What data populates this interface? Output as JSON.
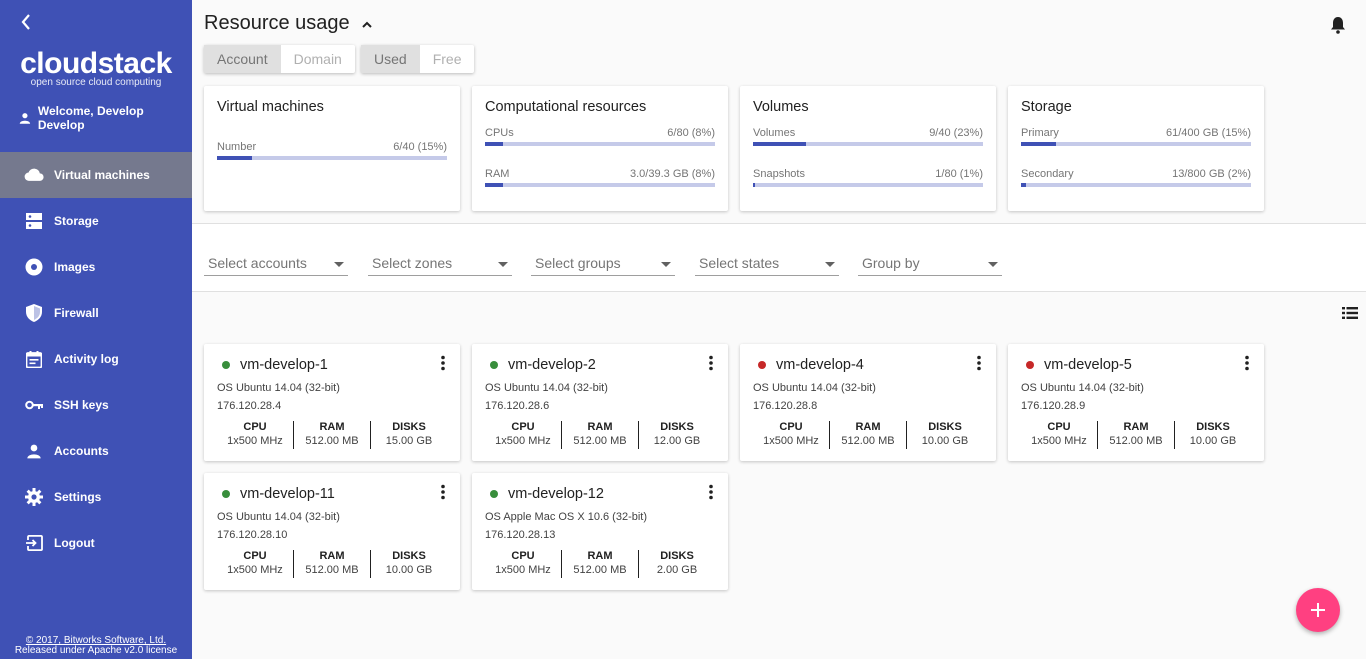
{
  "brand": {
    "name": "cloudstack",
    "tagline": "open source cloud computing"
  },
  "sidebar": {
    "welcome": "Welcome, Develop Develop",
    "items": [
      {
        "label": "Virtual machines",
        "icon": "cloud-icon",
        "active": true
      },
      {
        "label": "Storage",
        "icon": "storage-icon"
      },
      {
        "label": "Images",
        "icon": "disc-icon"
      },
      {
        "label": "Firewall",
        "icon": "shield-icon"
      },
      {
        "label": "Activity log",
        "icon": "event-note-icon"
      },
      {
        "label": "SSH keys",
        "icon": "key-icon"
      },
      {
        "label": "Accounts",
        "icon": "person-icon"
      },
      {
        "label": "Settings",
        "icon": "gear-icon"
      },
      {
        "label": "Logout",
        "icon": "exit-icon"
      }
    ],
    "footer_line1": "© 2017, Bitworks Software, Ltd.",
    "footer_line2": "Released under Apache v2.0 license"
  },
  "header": {
    "title": "Resource usage"
  },
  "toggles": {
    "scope": {
      "options": [
        "Account",
        "Domain"
      ],
      "selected": "Account"
    },
    "mode": {
      "options": [
        "Used",
        "Free"
      ],
      "selected": "Used"
    }
  },
  "usage": [
    {
      "title": "Virtual machines",
      "metrics": [
        {
          "label": "Number",
          "value": "6/40 (15%)",
          "fraction": 0.15
        }
      ]
    },
    {
      "title": "Computational resources",
      "metrics": [
        {
          "label": "CPUs",
          "value": "6/80 (8%)",
          "fraction": 0.08
        },
        {
          "label": "RAM",
          "value": "3.0/39.3 GB (8%)",
          "fraction": 0.08
        }
      ]
    },
    {
      "title": "Volumes",
      "metrics": [
        {
          "label": "Volumes",
          "value": "9/40 (23%)",
          "fraction": 0.23
        },
        {
          "label": "Snapshots",
          "value": "1/80 (1%)",
          "fraction": 0.01
        }
      ]
    },
    {
      "title": "Storage",
      "metrics": [
        {
          "label": "Primary",
          "value": "61/400 GB (15%)",
          "fraction": 0.15
        },
        {
          "label": "Secondary",
          "value": "13/800 GB (2%)",
          "fraction": 0.02
        }
      ]
    }
  ],
  "filters": [
    "Select accounts",
    "Select zones",
    "Select groups",
    "Select states",
    "Group by"
  ],
  "spec_labels": {
    "cpu": "CPU",
    "ram": "RAM",
    "disks": "DISKS"
  },
  "vms": [
    {
      "name": "vm-develop-1",
      "status_color": "#388e3c",
      "os": "OS Ubuntu 14.04 (32-bit)",
      "ip": "176.120.28.4",
      "cpu": "1x500 MHz",
      "ram": "512.00 MB",
      "disks": "15.00 GB"
    },
    {
      "name": "vm-develop-2",
      "status_color": "#388e3c",
      "os": "OS Ubuntu 14.04 (32-bit)",
      "ip": "176.120.28.6",
      "cpu": "1x500 MHz",
      "ram": "512.00 MB",
      "disks": "12.00 GB"
    },
    {
      "name": "vm-develop-4",
      "status_color": "#c62828",
      "os": "OS Ubuntu 14.04 (32-bit)",
      "ip": "176.120.28.8",
      "cpu": "1x500 MHz",
      "ram": "512.00 MB",
      "disks": "10.00 GB"
    },
    {
      "name": "vm-develop-5",
      "status_color": "#c62828",
      "os": "OS Ubuntu 14.04 (32-bit)",
      "ip": "176.120.28.9",
      "cpu": "1x500 MHz",
      "ram": "512.00 MB",
      "disks": "10.00 GB"
    },
    {
      "name": "vm-develop-11",
      "status_color": "#388e3c",
      "os": "OS Ubuntu 14.04 (32-bit)",
      "ip": "176.120.28.10",
      "cpu": "1x500 MHz",
      "ram": "512.00 MB",
      "disks": "10.00 GB"
    },
    {
      "name": "vm-develop-12",
      "status_color": "#388e3c",
      "os": "OS Apple Mac OS X 10.6 (32-bit)",
      "ip": "176.120.28.13",
      "cpu": "1x500 MHz",
      "ram": "512.00 MB",
      "disks": "2.00 GB"
    }
  ],
  "colors": {
    "primary": "#3f51b5",
    "accent": "#ff4081",
    "sidebar_active": "#75798e"
  }
}
